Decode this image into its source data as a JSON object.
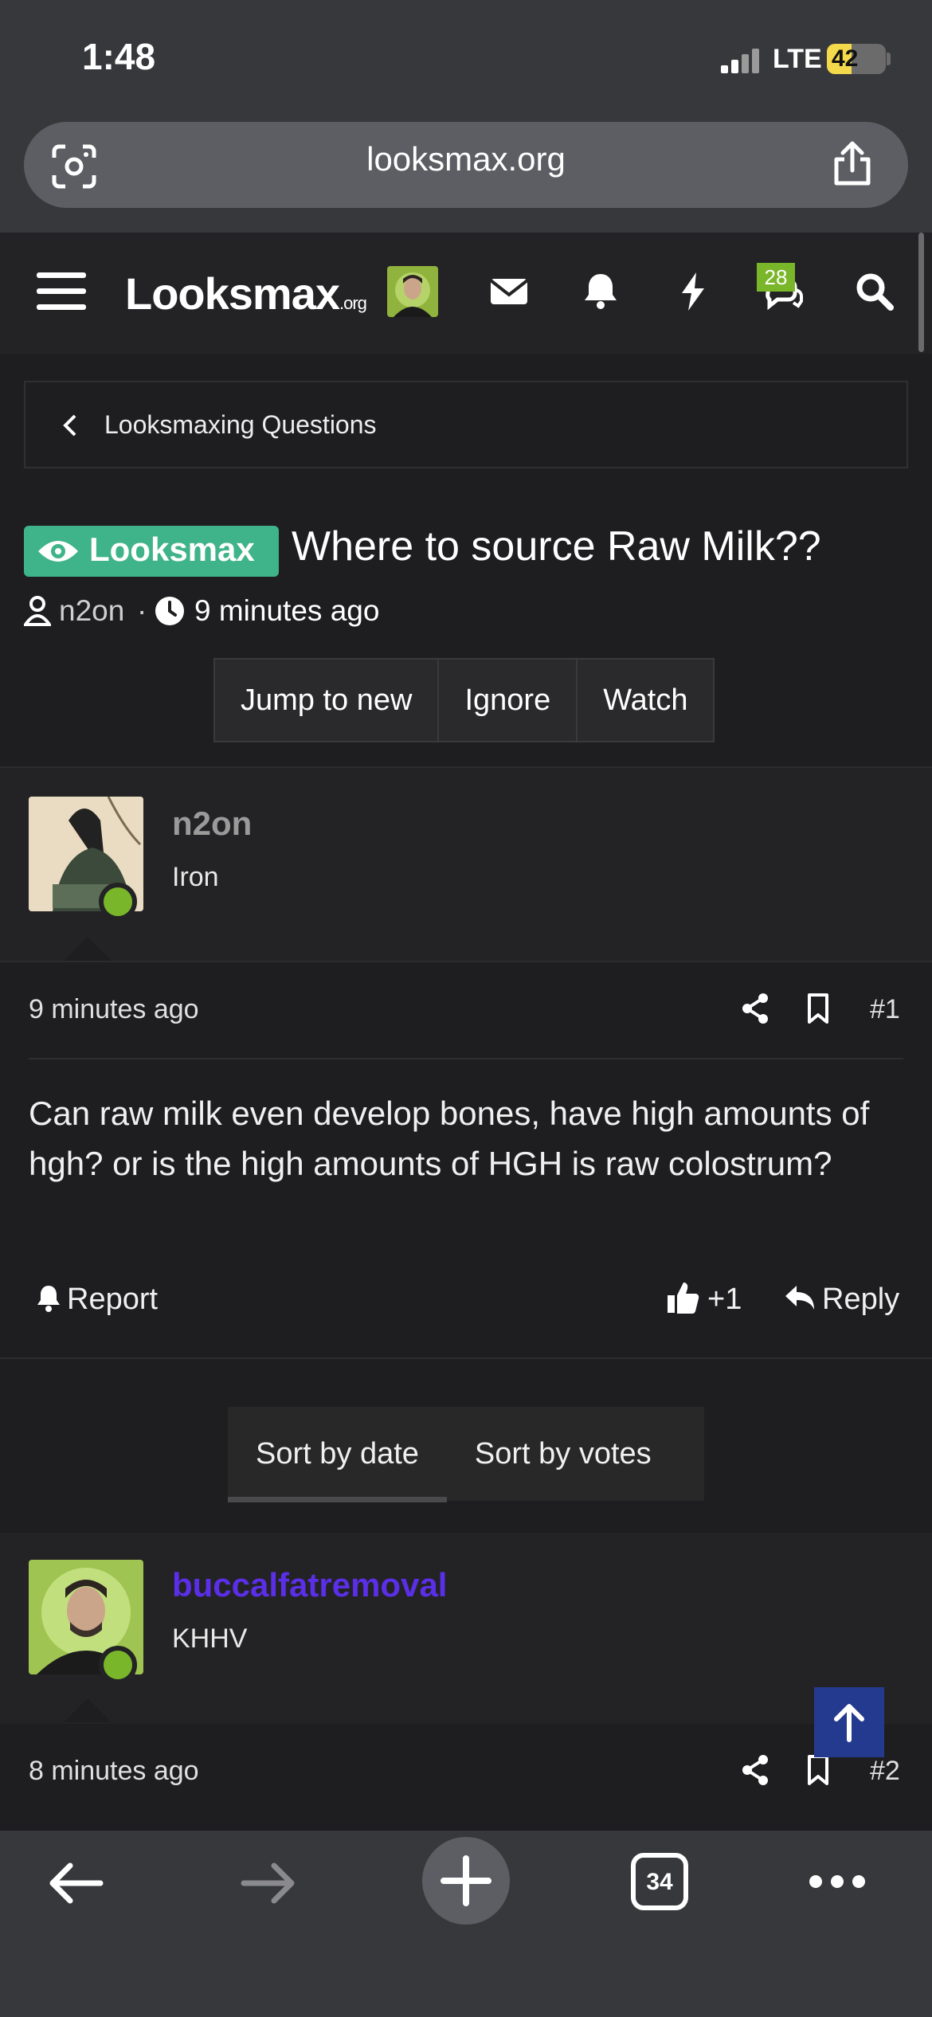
{
  "status_bar": {
    "time": "1:48",
    "network": "LTE",
    "battery": "42",
    "battery_level": 0.42
  },
  "browser": {
    "url": "looksmax.org",
    "tab_count": "34"
  },
  "site_header": {
    "logo_main": "Looksmax",
    "logo_suffix": ".org",
    "messages_badge": "28"
  },
  "breadcrumb": {
    "label": "Looksmaxing Questions"
  },
  "thread": {
    "prefix": "Looksmax",
    "title": "Where to source Raw Milk??",
    "author": "n2on",
    "separator": "·",
    "time": "9 minutes ago",
    "buttons": [
      "Jump to new",
      "Ignore",
      "Watch"
    ]
  },
  "posts": [
    {
      "username": "n2on",
      "user_title": "Iron",
      "time": "9 minutes ago",
      "number": "#1",
      "body": "Can raw milk even develop bones, have high amounts of hgh? or is the high amounts of HGH is raw colostrum?",
      "report": "Report",
      "reaction": "+1",
      "reply": "Reply"
    },
    {
      "username": "buccalfatremoval",
      "user_title": "KHHV",
      "time": "8 minutes ago",
      "number": "#2"
    }
  ],
  "sort_tabs": [
    "Sort by date",
    "Sort by votes"
  ],
  "colors": {
    "accent_green": "#7ab62a",
    "prefix_green": "#3fb38a",
    "username_purple": "#5b2ee8"
  }
}
